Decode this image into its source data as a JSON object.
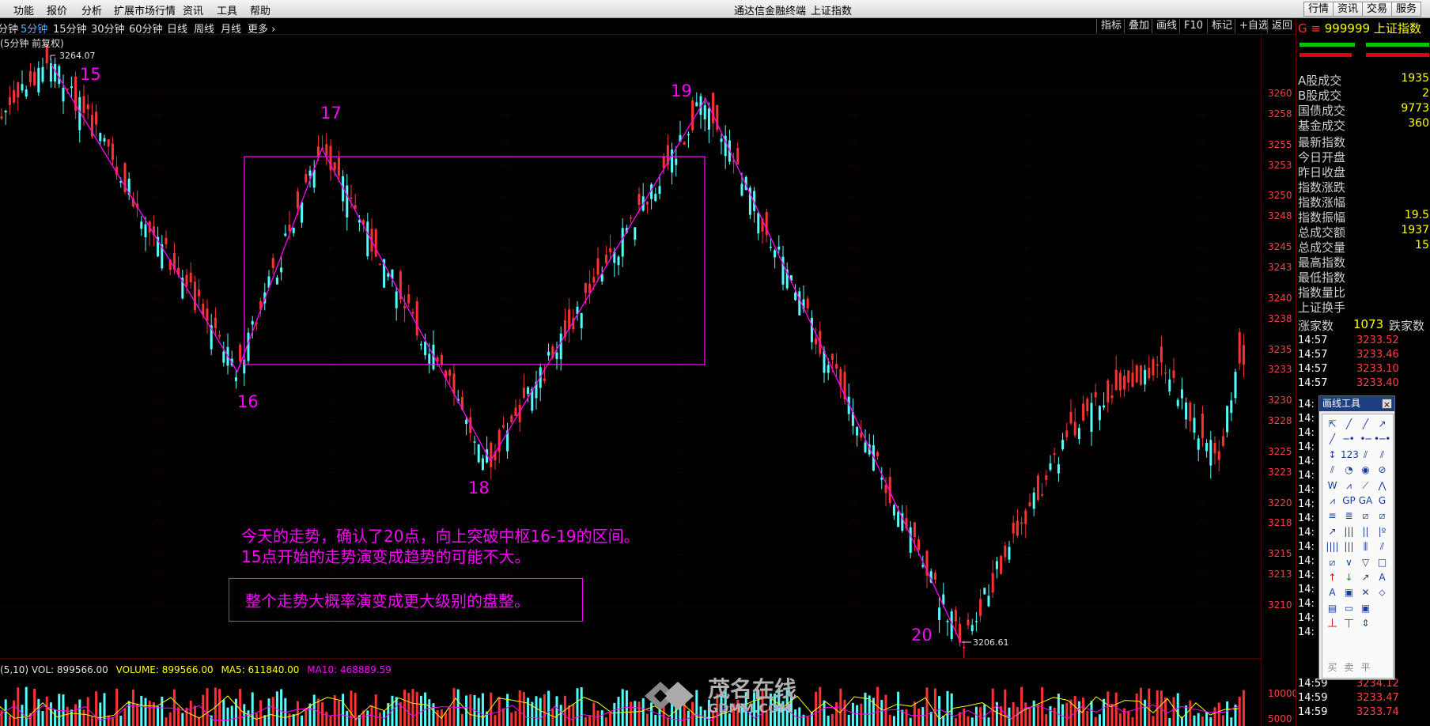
{
  "menu": [
    "功能",
    "报价",
    "分析",
    "扩展市场行情",
    "资讯",
    "工具",
    "帮助"
  ],
  "app_title": "通达信金融终端",
  "window_subtitle": "上证指数",
  "right_buttons": [
    "行情",
    "资讯",
    "交易",
    "服务"
  ],
  "periods": [
    "分钟",
    "5分钟",
    "15分钟",
    "30分钟",
    "60分钟",
    "日线",
    "周线",
    "月线",
    "更多 ›"
  ],
  "active_period": "5分钟",
  "chart_tools": [
    "指标",
    "叠加",
    "画线",
    "F10",
    "标记",
    "+自选",
    "返回"
  ],
  "chart_label": "(5分钟 前复权)",
  "high_label": "3264.07",
  "low_label": "3206.61",
  "colors": {
    "up": "#ff3232",
    "down": "#54ffff",
    "annotation": "#ff00ff",
    "ma5": "#ffff00",
    "ma10": "#ff00ff"
  },
  "wave_labels": [
    "15",
    "16",
    "17",
    "18",
    "19",
    "20"
  ],
  "notes": {
    "line1": "今天的走势，确认了20点，向上突破中枢16-19的区间。",
    "line2": "15点开始的走势演变成趋势的可能不大。",
    "boxed": "整个走势大概率演变成更大级别的盘整。"
  },
  "y_axis_labels": [
    "3260",
    "3258",
    "3255",
    "3253",
    "3250",
    "3248",
    "3245",
    "3243",
    "3240",
    "3238",
    "3235",
    "3233",
    "3230",
    "3228",
    "3225",
    "3223",
    "3220",
    "3218",
    "3215",
    "3213",
    "3210"
  ],
  "volume_axis_labels": [
    "10000",
    "5000"
  ],
  "volume_legend": {
    "prefix": "(5,10)",
    "vol": "VOL: 899566.00",
    "volume": "VOLUME: 899566.00",
    "ma5": "MA5: 611840.00",
    "ma10": "MA10: 468889.59"
  },
  "right_panel": {
    "code": "999999",
    "name": "上证指数",
    "market_rows": [
      {
        "label": "A股成交",
        "value": "1935"
      },
      {
        "label": "B股成交",
        "value": "2"
      },
      {
        "label": "国债成交",
        "value": "9773"
      },
      {
        "label": "基金成交",
        "value": "360"
      }
    ],
    "index_rows": [
      {
        "label": "最新指数",
        "value": ""
      },
      {
        "label": "今日开盘",
        "value": ""
      },
      {
        "label": "昨日收盘",
        "value": ""
      },
      {
        "label": "指数涨跌",
        "value": ""
      },
      {
        "label": "指数涨幅",
        "value": ""
      },
      {
        "label": "指数振幅",
        "value": "19.5"
      },
      {
        "label": "总成交额",
        "value": "1937"
      },
      {
        "label": "总成交量",
        "value": "15"
      },
      {
        "label": "最高指数",
        "value": ""
      },
      {
        "label": "最低指数",
        "value": ""
      },
      {
        "label": "指数量比",
        "value": ""
      },
      {
        "label": "上证换手",
        "value": ""
      }
    ],
    "rise_fall": {
      "rise_label": "涨家数",
      "rise": "1073",
      "fall_label": "跌家数"
    },
    "ticks_top": [
      {
        "time": "14:57",
        "price": "3233.52"
      },
      {
        "time": "14:57",
        "price": "3233.46"
      },
      {
        "time": "14:57",
        "price": "3233.10"
      },
      {
        "time": "14:57",
        "price": "3233.40"
      }
    ],
    "ticks_left": [
      "14:",
      "14:",
      "14:",
      "14:",
      "14:",
      "14:",
      "14:",
      "14:",
      "14:",
      "14:",
      "14:",
      "14:",
      "14:",
      "14:",
      "14:",
      "14:",
      "14:"
    ],
    "ticks_bottom": [
      {
        "time": "14:59",
        "price": "3234.12"
      },
      {
        "time": "14:59",
        "price": "3233.47"
      },
      {
        "time": "14:59",
        "price": "3233.74"
      }
    ]
  },
  "draw_tools": {
    "title": "画线工具",
    "close": "×",
    "bottom_labels": [
      "买",
      "卖",
      "平"
    ]
  },
  "watermark": {
    "cn": "茂名在线",
    "en": "GDMM.COM"
  }
}
